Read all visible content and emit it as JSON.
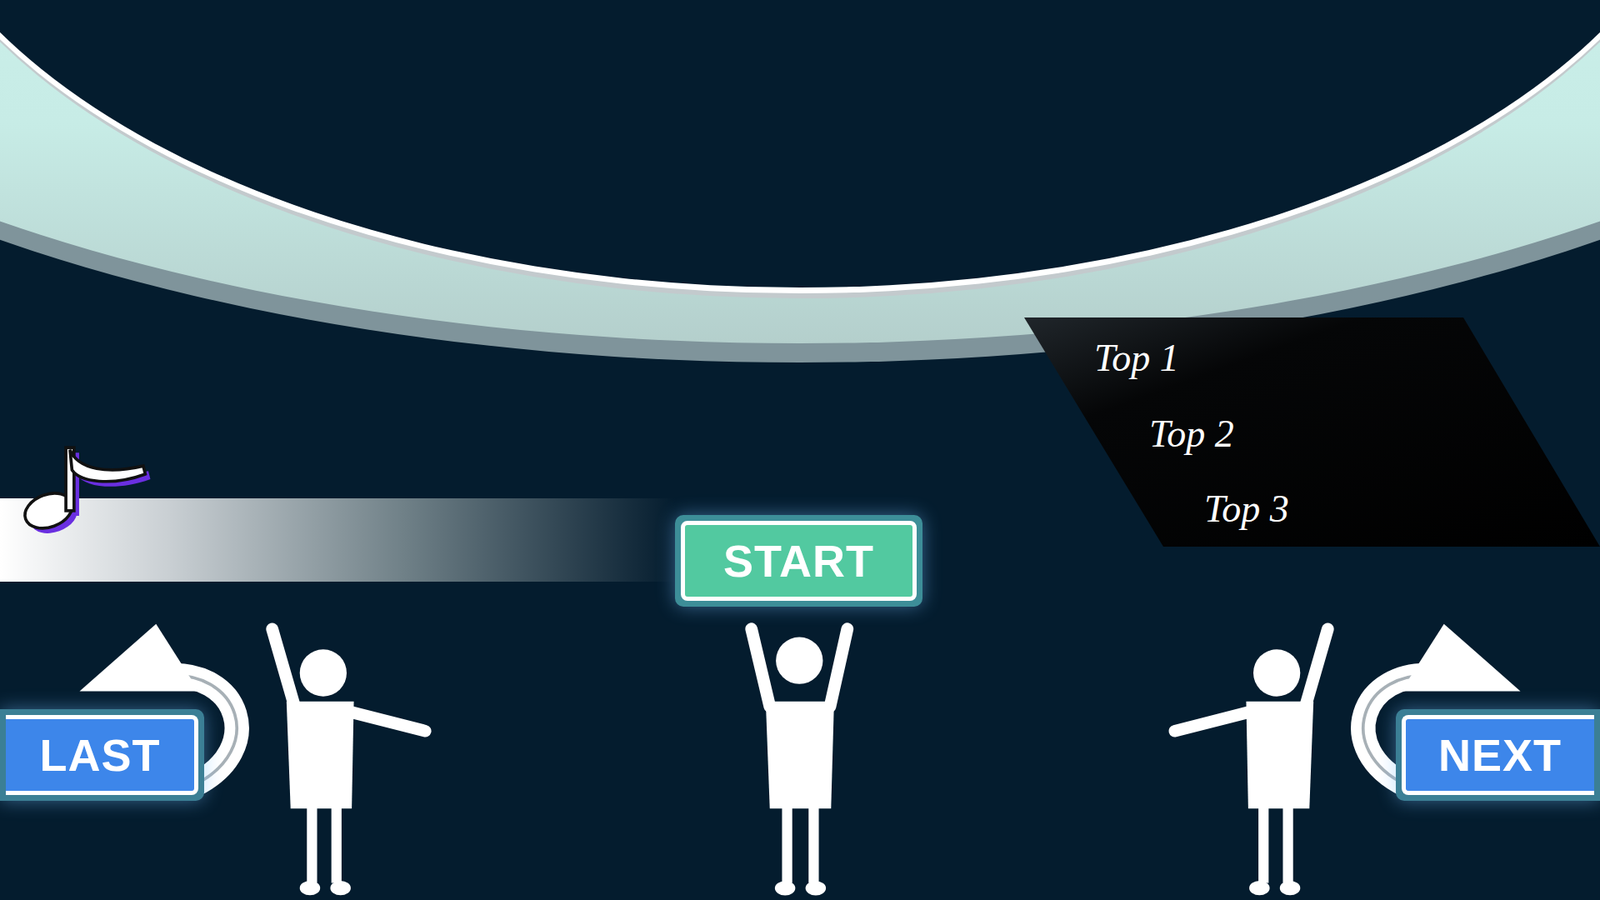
{
  "leaderboard": {
    "entries": [
      {
        "label": "Top 1"
      },
      {
        "label": "Top 2"
      },
      {
        "label": "Top 3"
      }
    ]
  },
  "buttons": {
    "start": "START",
    "last": "LAST",
    "next": "NEXT"
  }
}
